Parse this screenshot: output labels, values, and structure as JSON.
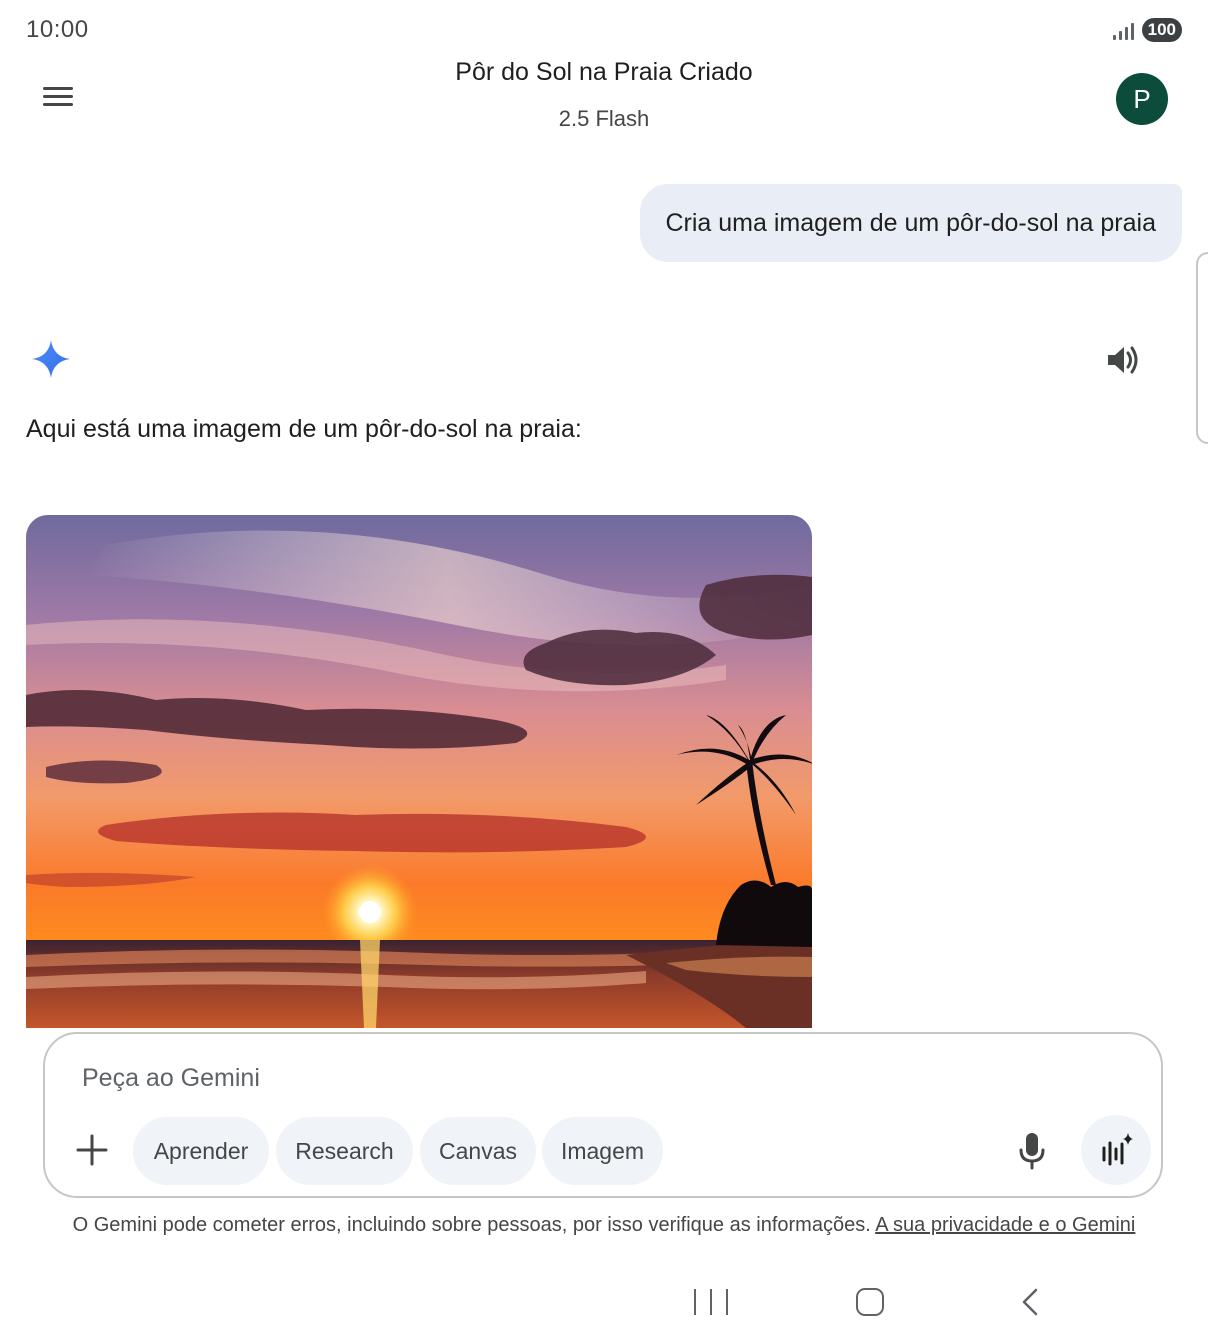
{
  "status_bar": {
    "time": "10:00",
    "battery": "100",
    "signal_icon": "signal-icon"
  },
  "header": {
    "title": "Pôr do Sol na Praia Criado",
    "model": "2.5 Flash",
    "avatar_initial": "P",
    "avatar_color": "#0b4d3a",
    "menu_icon": "menu-icon"
  },
  "conversation": {
    "user_message": "Cria uma imagem de um pôr-do-sol na praia",
    "response_text": "Aqui está uma imagem de um pôr-do-sol na praia:",
    "response_icons": [
      "gemini-sparkle-icon",
      "speaker-icon"
    ],
    "image": "beach-sunset-image"
  },
  "input": {
    "placeholder": "Peça ao Gemini",
    "chips": [
      "Aprender",
      "Research",
      "Canvas",
      "Imagem"
    ],
    "icons": [
      "plus-icon",
      "microphone-icon",
      "live-icon"
    ]
  },
  "disclaimer": {
    "text": "O Gemini pode cometer erros, incluindo sobre pessoas, por isso verifique as informações. ",
    "link": "A sua privacidade e o Gemini"
  },
  "colors": {
    "accent": "#4285f4",
    "bubble": "#e9eef6",
    "chip": "#f0f4f9"
  }
}
